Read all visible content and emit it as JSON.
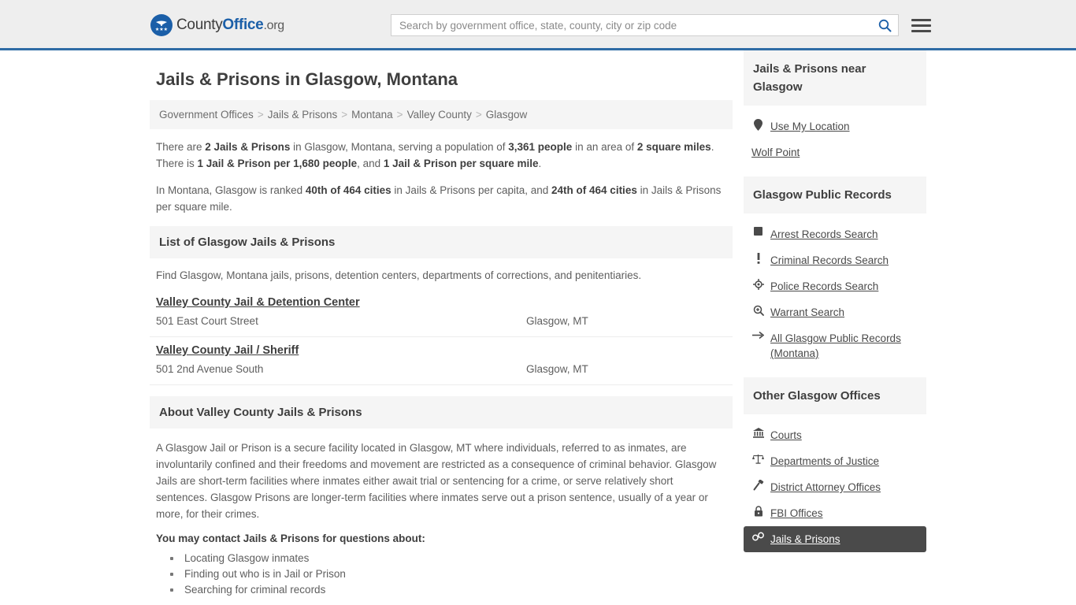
{
  "header": {
    "logo": {
      "part1": "County",
      "part2": "Office",
      "tld": ".org",
      "icon": "eagle-seal-icon"
    },
    "search": {
      "placeholder": "Search by government office, state, county, city or zip code",
      "value": ""
    },
    "search_icon": "search-icon",
    "menu_icon": "hamburger-menu-icon"
  },
  "main": {
    "title": "Jails & Prisons in Glasgow, Montana",
    "breadcrumb": [
      "Government Offices",
      "Jails & Prisons",
      "Montana",
      "Valley County",
      "Glasgow"
    ],
    "breadcrumb_sep": ">",
    "intro": {
      "p1_a": "There are ",
      "p1_b1": "2 Jails & Prisons",
      "p1_c": " in Glasgow, Montana, serving a population of ",
      "p1_b2": "3,361 people",
      "p1_d": " in an area of ",
      "p1_b3": "2 square miles",
      "p1_e": ". There is ",
      "p1_b4": "1 Jail & Prison per 1,680 people",
      "p1_f": ", and ",
      "p1_b5": "1 Jail & Prison per square mile",
      "p1_g": ".",
      "p2_a": "In Montana, Glasgow is ranked ",
      "p2_b1": "40th of 464 cities",
      "p2_c": " in Jails & Prisons per capita, and ",
      "p2_b2": "24th of 464 cities",
      "p2_d": " in Jails & Prisons per square mile."
    },
    "list_section": {
      "heading": "List of Glasgow Jails & Prisons",
      "sub": "Find Glasgow, Montana jails, prisons, detention centers, departments of corrections, and penitentiaries.",
      "items": [
        {
          "name": "Valley County Jail & Detention Center",
          "address": "501 East Court Street",
          "citystate": "Glasgow, MT"
        },
        {
          "name": "Valley County Jail / Sheriff",
          "address": "501 2nd Avenue South",
          "citystate": "Glasgow, MT"
        }
      ]
    },
    "about_section": {
      "heading": "About Valley County Jails & Prisons",
      "paragraph": "A Glasgow Jail or Prison is a secure facility located in Glasgow, MT where individuals, referred to as inmates, are involuntarily confined and their freedoms and movement are restricted as a consequence of criminal behavior. Glasgow Jails are short-term facilities where inmates either await trial or sentencing for a crime, or serve relatively short sentences. Glasgow Prisons are longer-term facilities where inmates serve out a prison sentence, usually of a year or more, for their crimes.",
      "lead": "You may contact Jails & Prisons for questions about:",
      "bullets": [
        "Locating Glasgow inmates",
        "Finding out who is in Jail or Prison",
        "Searching for criminal records"
      ]
    }
  },
  "sidebar": {
    "near": {
      "heading": "Jails & Prisons near Glasgow",
      "links": [
        {
          "label": "Use My Location",
          "icon": "map-pin-icon"
        },
        {
          "label": "Wolf Point",
          "icon": ""
        }
      ]
    },
    "public_records": {
      "heading": "Glasgow Public Records",
      "links": [
        {
          "label": "Arrest Records Search",
          "icon": "square-icon"
        },
        {
          "label": "Criminal Records Search",
          "icon": "exclamation-icon"
        },
        {
          "label": "Police Records Search",
          "icon": "police-badge-icon"
        },
        {
          "label": "Warrant Search",
          "icon": "magnifier-plus-icon"
        },
        {
          "label": "All Glasgow Public Records (Montana)",
          "icon": "arrow-right-icon"
        }
      ]
    },
    "other_offices": {
      "heading": "Other Glasgow Offices",
      "links": [
        {
          "label": "Courts",
          "icon": "courthouse-icon",
          "active": false
        },
        {
          "label": "Departments of Justice",
          "icon": "scales-icon",
          "active": false
        },
        {
          "label": "District Attorney Offices",
          "icon": "gavel-icon",
          "active": false
        },
        {
          "label": "FBI Offices",
          "icon": "lock-icon",
          "active": false
        },
        {
          "label": "Jails & Prisons",
          "icon": "handcuffs-icon",
          "active": true
        }
      ]
    }
  },
  "colors": {
    "brand_blue": "#1b5fa8",
    "header_bg": "#eeeeee",
    "header_border": "#2f6ca5",
    "section_bg": "#f5f5f5",
    "active_bg": "#4a4a4a",
    "body_text": "#5e5e5e"
  }
}
